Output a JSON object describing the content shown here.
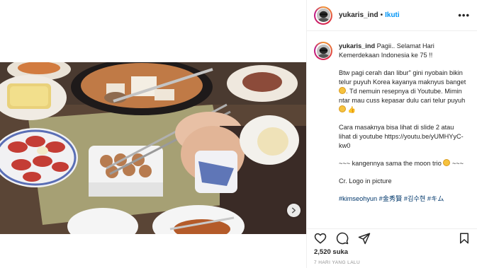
{
  "post": {
    "username": "yukaris_ind",
    "follow_label": "Ikuti",
    "more_label": "•••",
    "separator": "•"
  },
  "caption": {
    "username": "yukaris_ind",
    "line1": "Pagii.. Selamat Hari Kemerdekaan Indonesia ke 75 !!",
    "para2": "Btw pagi cerah dan libur\" gini nyobain bikin telur puyuh Korea kayanya maknyus banget",
    "para2b": ". Td nemuin resepnya di Youtube. Mimin ntar mau cuss kepasar dulu cari telur puyuh",
    "para3": "Cara masaknya bisa lihat di slide 2 atau lihat di youtube",
    "link": "https://youtu.be/yUMHYyC-kw0",
    "para4a": "~~~ kangennya sama the moon trio",
    "para4b": "~~~",
    "para5": "Cr. Logo in picture",
    "hashtags": "#kimseohyun #金秀賢 #김수현 #キム"
  },
  "actions": {
    "like_icon": "heart-icon",
    "comment_icon": "comment-icon",
    "share_icon": "paper-plane-icon",
    "save_icon": "bookmark-icon"
  },
  "likes": "2,520 suka",
  "timestamp": "7 HARI YANG LALU",
  "colors": {
    "follow_blue": "#0095f6",
    "hashtag": "#00376b",
    "border": "#efefef",
    "muted": "#8e8e8e"
  }
}
